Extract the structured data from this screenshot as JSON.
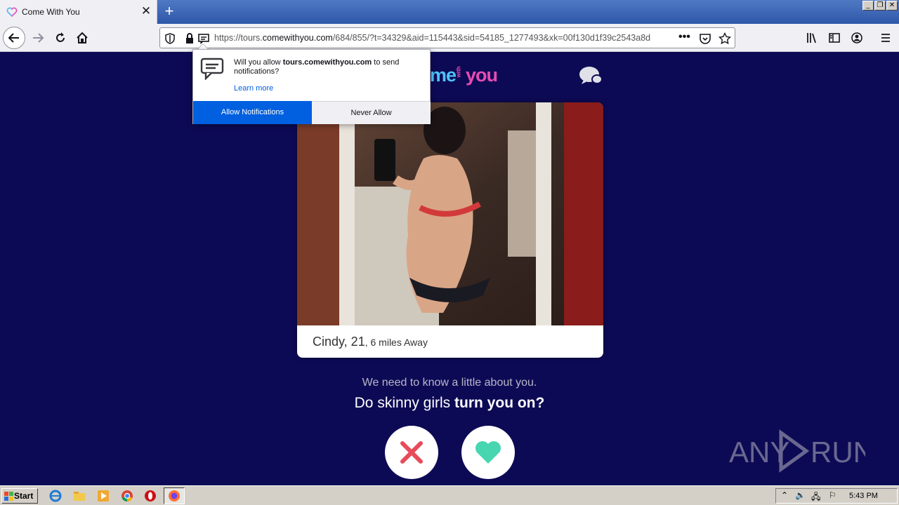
{
  "browser": {
    "tab_title": "Come With You",
    "url_prefix": "https://tours.",
    "url_domain": "comewithyou.com",
    "url_rest": "/684/855/?t=34329&aid=115443&sid=54185_1277493&xk=00f130d1f39c2543a8d"
  },
  "notification": {
    "msg_prefix": "Will you allow ",
    "msg_site": "tours.comewithyou.com",
    "msg_suffix": " to send notifications?",
    "learn_more": "Learn more",
    "allow_label": "Allow Notifications",
    "never_label": "Never Allow"
  },
  "site": {
    "logo_me": "me",
    "logo_with": "with",
    "logo_you": "you"
  },
  "profile": {
    "name_age": "Cindy, 21",
    "distance": "6 miles Away"
  },
  "question": {
    "intro": "We need to know a little about you.",
    "prefix": "Do skinny girls ",
    "emphasis": "turn you on?"
  },
  "taskbar": {
    "start_label": "Start",
    "clock": "5:43 PM"
  },
  "watermark": {
    "text_left": "ANY",
    "text_right": "RUN"
  },
  "colors": {
    "page_bg": "#0d0a55",
    "allow_blue": "#0060df",
    "no_red": "#e84b5a",
    "yes_teal": "#48d6b0"
  }
}
